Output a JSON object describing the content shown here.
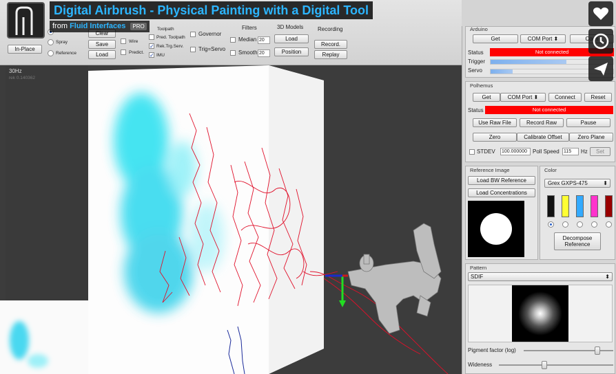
{
  "video": {
    "title": "Digital Airbrush - Physical Painting with a Digital Tool",
    "from_prefix": "from",
    "channel": "Fluid Interfaces",
    "badge": "PRO"
  },
  "toolbar": {
    "in_place": "In-Place",
    "mode_radios": [
      "Spray",
      "Reference"
    ],
    "clear": "Clear",
    "save": "Save",
    "load": "Load",
    "wire": "Wire",
    "predict": "Predict.",
    "checks": [
      "Toolpath",
      "Pred. Toolpath",
      "Rek.Trg.Serv.",
      "IMU"
    ],
    "governor": "Governor",
    "trig_servo": "Trig=Servo",
    "filters_label": "Filters",
    "median": "Median",
    "median_value": "20",
    "smooth": "Smooth",
    "smooth_value": "20",
    "models_label": "3D Models",
    "models_load": "Load",
    "models_position": "Position",
    "recording_label": "Recording",
    "record": "Record.",
    "replay": "Replay"
  },
  "viewport": {
    "fps": "30Hz",
    "subinfo": "rek 0.140362"
  },
  "arduino": {
    "title": "Arduino",
    "get": "Get",
    "com_port": "COM Port",
    "connect": "Conn",
    "status_label": "Status",
    "status_value": "Not connected",
    "trigger_label": "Trigger",
    "servo_label": "Servo",
    "trigger_level": 0.62,
    "servo_level": 0.18
  },
  "polhemus": {
    "title": "Polhemus",
    "get": "Get",
    "com_port": "COM Port",
    "connect": "Connect",
    "reset": "Reset",
    "status_label": "Status",
    "status_value": "Not connected",
    "use_raw_file": "Use Raw File",
    "record_raw": "Record Raw",
    "pause": "Pause",
    "zero": "Zero",
    "calibrate_offset": "Calibrate Offset",
    "zero_plane": "Zero Plane",
    "stdev": "STDEV",
    "stdev_value": "100.000000",
    "poll_speed": "Poll Speed",
    "poll_value": "115",
    "hz": "Hz",
    "set": "Set"
  },
  "reference": {
    "title": "Reference Image",
    "load_bw": "Load BW Reference",
    "load_conc": "Load Concentrations"
  },
  "color": {
    "title": "Color",
    "preset": "Grex GXPS-475",
    "swatches": [
      "#111111",
      "#ffff33",
      "#33aaff",
      "#ff33cc",
      "#990000"
    ],
    "selected_index": 0,
    "decompose": "Decompose Reference"
  },
  "pattern": {
    "title": "Pattern",
    "selected": "SDIF",
    "pigment_label": "Pigment factor (log)",
    "pigment_value": 0.82,
    "wideness_label": "Wideness",
    "wideness_value": 0.38
  },
  "overlay_icons": [
    "heart-icon",
    "clock-icon",
    "send-icon"
  ]
}
